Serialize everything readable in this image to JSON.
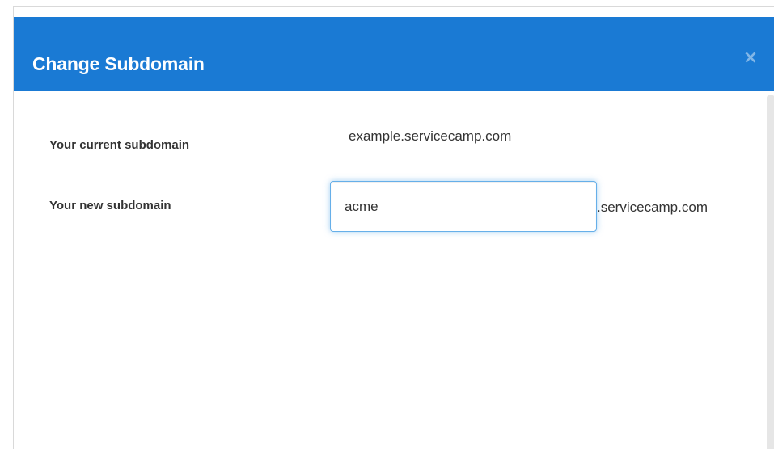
{
  "modal": {
    "title": "Change Subdomain",
    "close_label": "×"
  },
  "form": {
    "current_label": "Your current subdomain",
    "current_value": "example.servicecamp.com",
    "new_label": "Your new subdomain",
    "new_value": "acme",
    "suffix": ".servicecamp.com"
  },
  "colors": {
    "header_bg": "#1a7ad4",
    "focus_border": "#66afe9"
  }
}
